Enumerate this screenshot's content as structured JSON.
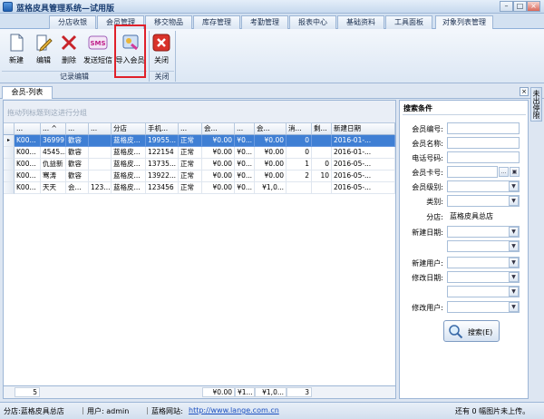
{
  "window": {
    "title": "蓝格皮具管理系统—试用版",
    "minimize": "–",
    "restore": "□",
    "close": "×"
  },
  "menu_tabs": [
    "分店收银",
    "会员管理",
    "移交物品",
    "库存管理",
    "考勤管理",
    "报表中心",
    "基础资料",
    "工具面板",
    "对象列表管理"
  ],
  "ribbon": {
    "buttons": [
      "新建",
      "编辑",
      "删除",
      "发送短信",
      "导入会员",
      "关闭"
    ],
    "groups": [
      "记录编辑",
      "关闭"
    ],
    "sms_icon_text": "SMS"
  },
  "doc_tab": "会员-列表",
  "side_handle": "未出停限",
  "grid": {
    "group_hint": "拖动列标题到这进行分组",
    "columns": [
      "...",
      "... ^",
      "...",
      "...",
      "分店",
      "手机...",
      "...",
      "会...",
      "...",
      "会...",
      "消...",
      "剩...",
      "新建日期"
    ],
    "rows": [
      {
        "indicator": "▸",
        "cells": [
          "K00...",
          "36999",
          "歡容",
          "",
          "蓝格皮...",
          "19955...",
          "正常",
          "¥0.00",
          "¥0...",
          "¥0.00",
          "0",
          "",
          "2016-01-..."
        ]
      },
      {
        "indicator": "",
        "cells": [
          "K00...",
          "4545...",
          "歡容",
          "",
          "蓝格皮...",
          "122154",
          "正常",
          "¥0.00",
          "¥0...",
          "¥0.00",
          "0",
          "",
          "2016-01-..."
        ]
      },
      {
        "indicator": "",
        "cells": [
          "K00...",
          "仇益新",
          "歡容",
          "",
          "蓝格皮...",
          "13735...",
          "正常",
          "¥0.00",
          "¥0...",
          "¥0.00",
          "1",
          "0",
          "2016-05-..."
        ]
      },
      {
        "indicator": "",
        "cells": [
          "K00...",
          "骞涛",
          "歡容",
          "",
          "蓝格皮...",
          "13922...",
          "正常",
          "¥0.00",
          "¥0...",
          "¥0.00",
          "2",
          "10",
          "2016-05-..."
        ]
      },
      {
        "indicator": "",
        "cells": [
          "K00...",
          "天天",
          "会...",
          "123...",
          "蓝格皮...",
          "123456",
          "正常",
          "¥0.00",
          "¥0...",
          "¥1,0...",
          "",
          "",
          "2016-05-..."
        ]
      }
    ],
    "footer": {
      "count": "5",
      "sum1": "¥0.00",
      "sum2": "¥1...",
      "sum3": "¥1,0...",
      "sum4": "3"
    }
  },
  "search": {
    "title": "搜索条件",
    "fields": [
      {
        "label": "会员编号:",
        "value": ""
      },
      {
        "label": "会员名称:",
        "value": ""
      },
      {
        "label": "电话号码:",
        "value": ""
      },
      {
        "label": "会员卡号:",
        "value": ""
      },
      {
        "label": "会员级别:",
        "value": ""
      },
      {
        "label": "类别:",
        "value": ""
      },
      {
        "label": "分店:",
        "value": "蓝格皮具总店"
      },
      {
        "label": "新建日期:",
        "value": ""
      },
      {
        "label": "",
        "value": ""
      },
      {
        "label": "新建用户:",
        "value": ""
      },
      {
        "label": "修改日期:",
        "value": ""
      },
      {
        "label": "",
        "value": ""
      },
      {
        "label": "修改用户:",
        "value": ""
      }
    ],
    "browse_button": "...",
    "search_button": "搜索(E)"
  },
  "statusbar": {
    "store": "分店:蓝格皮具总店",
    "user": "用户: admin",
    "site_label": "蓝格网站:",
    "site_link": "http://www.lange.com.cn",
    "upload_status": "还有 0 幅图片未上传。"
  },
  "colors": {
    "selection": "#3f7fd4",
    "highlight": "#e0202a",
    "link": "#1a4fc0"
  }
}
